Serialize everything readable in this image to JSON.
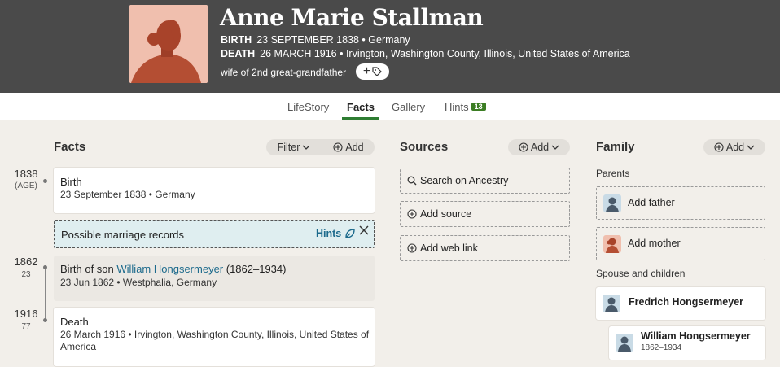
{
  "person": {
    "name": "Anne Marie Stallman",
    "birth_label": "BIRTH",
    "birth_value": "23 SEPTEMBER 1838 • Germany",
    "death_label": "DEATH",
    "death_value": "26 MARCH 1916 • Irvington, Washington County, Illinois, United States of America",
    "relationship": "wife of 2nd great-grandfather",
    "tag_button_icon": "+"
  },
  "tabs": [
    {
      "label": "LifeStory"
    },
    {
      "label": "Facts"
    },
    {
      "label": "Gallery"
    },
    {
      "label": "Hints",
      "badge": "13"
    }
  ],
  "facts": {
    "title": "Facts",
    "filter_label": "Filter",
    "add_label": "Add",
    "timeline": [
      {
        "year": "1838",
        "age": "(AGE)"
      },
      {
        "year": "1862",
        "age": "23"
      },
      {
        "year": "1916",
        "age": "77"
      }
    ],
    "birth": {
      "title": "Birth",
      "detail": "23 September 1838 • Germany"
    },
    "hint": {
      "text": "Possible marriage records",
      "link": "Hints"
    },
    "son": {
      "prefix": "Birth of son ",
      "name": "William Hongsermeyer",
      "years": " (1862–1934)",
      "detail": "23 Jun 1862 • Westphalia, Germany"
    },
    "death": {
      "title": "Death",
      "detail_line1": "26 March 1916 • Irvington, Washington County, Illinois, United States of",
      "detail_line2": "America"
    }
  },
  "sources": {
    "title": "Sources",
    "add_label": "Add",
    "buttons": [
      {
        "label": "Search on Ancestry"
      },
      {
        "label": "Add source"
      },
      {
        "label": "Add web link"
      }
    ]
  },
  "family": {
    "title": "Family",
    "add_label": "Add",
    "parents_label": "Parents",
    "add_father": "Add father",
    "add_mother": "Add mother",
    "spouse_label": "Spouse and children",
    "spouse": {
      "name": "Fredrich Hongsermeyer"
    },
    "child": {
      "name": "William Hongsermeyer",
      "years": "1862–1934"
    }
  },
  "colors": {
    "header_bg": "#4a4a4a",
    "accent_green": "#2e7d32",
    "link_blue": "#1c6a8c",
    "hint_bg": "#dfeef0"
  }
}
